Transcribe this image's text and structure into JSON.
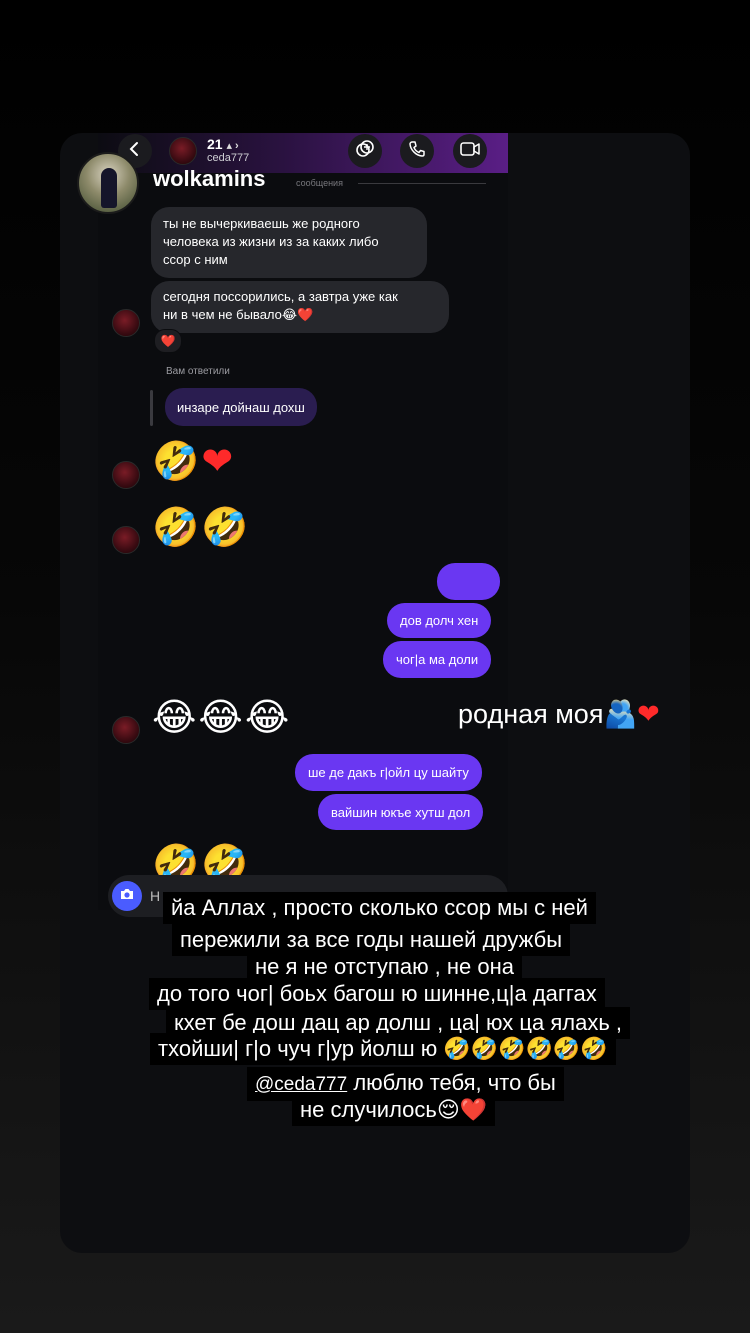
{
  "screenshot": {
    "poster": {
      "name": "wolkamins"
    },
    "chat_header": {
      "contact_name": "21",
      "contact_username": "ceda777",
      "messages_label": "сообщения"
    },
    "messages": {
      "m1": [
        "ты не вычеркиваешь же родного",
        "человека из жизни из за каких либо",
        "ссор с ним"
      ],
      "m2": [
        "сегодня поссорились, а завтра уже как",
        "ни в чем не бывало😂❤️"
      ],
      "reaction": "❤️",
      "reply_label": "Вам ответили",
      "reply_text": "инзаре дойнаш дохш",
      "emoji_row1": [
        "🤣",
        "❤"
      ],
      "emoji_row2": [
        "🤣",
        "🤣"
      ],
      "out1": "",
      "out2": "дов долч хен",
      "out3": "чог|а ма доли",
      "emoji_row3": [
        "😂",
        "😂",
        "😂"
      ],
      "out4": "ше де дакъ г|ойл цу шайту",
      "out5": "вайшин юкъе хутш дол",
      "emoji_row4": [
        "🤣",
        "🤣"
      ]
    },
    "compose": {
      "placeholder": "Н"
    },
    "side_caption": {
      "text": "родная моя",
      "emoji": "🫂",
      "heart": "❤"
    },
    "caption_lines": [
      "йа Аллах , просто сколько ссор мы с ней",
      "пережили за все годы нашей дружбы",
      "не я не отступаю , не она",
      "до того чог| боьх багош ю шинне,ц|а даггах",
      "кхет бе дош дац ар долш , ца| юх ца ялахь ,",
      "тхойши| г|о чуч г|ур йолш ю 🤣🤣🤣🤣🤣🤣"
    ],
    "mention": "@ceda777",
    "caption_after_mention": " люблю тебя, что бы",
    "caption_last": "не случилось😌❤️"
  }
}
